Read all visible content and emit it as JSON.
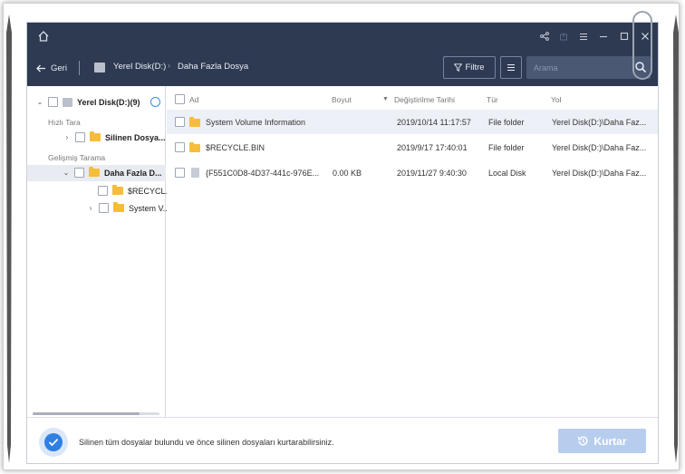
{
  "window": {
    "title_icons": [
      "home-icon",
      "share-icon",
      "upload-icon",
      "menu-icon",
      "minimize-icon",
      "maximize-icon",
      "close-icon"
    ]
  },
  "navbar": {
    "back_label": "Geri",
    "breadcrumb": [
      "Yerel Disk(D:)",
      "Daha Fazla Dosya"
    ],
    "filter_label": "Filtre",
    "search_placeholder": "Arama"
  },
  "sidebar": {
    "root": "Yerel Disk(D:)(9)",
    "quick_scan_label": "Hızlı Tara",
    "quick_items": [
      "Silinen Dosya..."
    ],
    "deep_scan_label": "Gelişmiş Tarama",
    "deep_items": [
      {
        "label": "Daha Fazla D...",
        "children": [
          "$RECYCL...",
          "System V..."
        ]
      }
    ]
  },
  "table": {
    "columns": {
      "name": "Ad",
      "size": "Boyut",
      "date": "Değiştirilme Tarihi",
      "type": "Tür",
      "path": "Yol"
    },
    "rows": [
      {
        "name": "System Volume Information",
        "size": "",
        "date": "2019/10/14 11:17:57",
        "type": "File folder",
        "path": "Yerel Disk(D:)\\Daha Faz..."
      },
      {
        "name": "$RECYCLE.BIN",
        "size": "",
        "date": "2019/9/17 17:40:01",
        "type": "File folder",
        "path": "Yerel Disk(D:)\\Daha Faz..."
      },
      {
        "name": "{F551C0D8-4D37-441c-976E...",
        "size": "0.00 KB",
        "date": "2019/11/27 9:40:30",
        "type": "Local Disk",
        "path": "Yerel Disk(D:)\\Daha Faz..."
      }
    ]
  },
  "footer": {
    "message": "Silinen tüm dosyalar bulundu ve önce silinen dosyaları kurtarabilirsiniz.",
    "recover_label": "Kurtar"
  },
  "colors": {
    "header_bg": "#2e3a52",
    "accent": "#2f7fe3",
    "recover_disabled": "#b7cdee",
    "folder": "#f6bc3c"
  }
}
